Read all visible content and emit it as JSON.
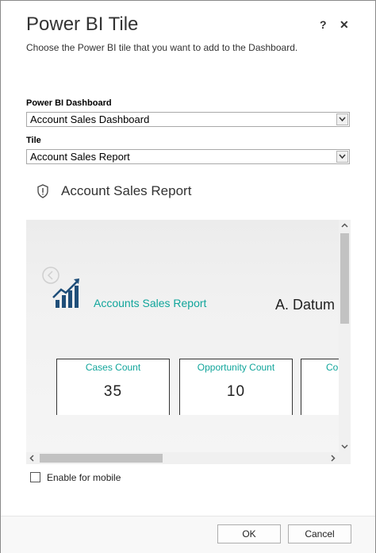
{
  "dialog": {
    "title": "Power BI Tile",
    "subtitle": "Choose the Power BI tile that you want to add to the Dashboard.",
    "help_label": "?",
    "close_label": "✕"
  },
  "form": {
    "dashboard_label": "Power BI Dashboard",
    "dashboard_value": "Account Sales Dashboard",
    "tile_label": "Tile",
    "tile_value": "Account Sales Report"
  },
  "tile_preview": {
    "title": "Account Sales Report",
    "report_title": "Accounts Sales Report",
    "report_right_text": "A. Datum",
    "cards": [
      {
        "title": "Cases Count",
        "value": "35"
      },
      {
        "title": "Opportunity Count",
        "value": "10"
      },
      {
        "title": "Co",
        "value": ""
      }
    ]
  },
  "mobile": {
    "label": "Enable for mobile",
    "checked": false
  },
  "buttons": {
    "ok": "OK",
    "cancel": "Cancel"
  },
  "colors": {
    "accent": "#11a59b"
  }
}
